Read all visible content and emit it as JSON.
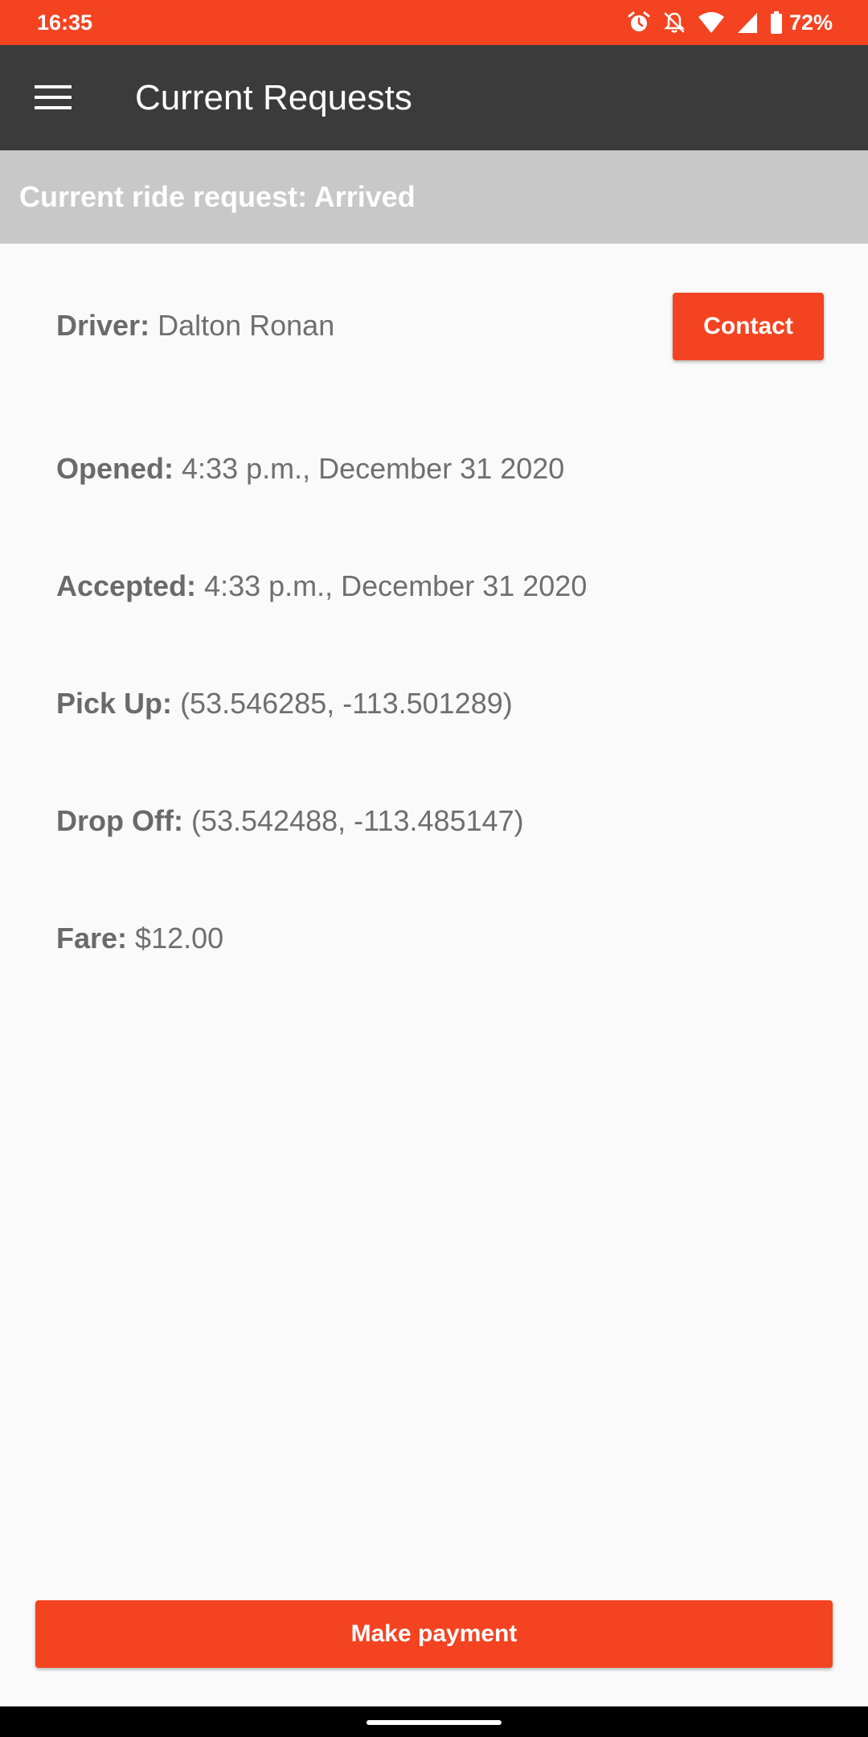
{
  "status_bar": {
    "time": "16:35",
    "battery": "72%",
    "icons": [
      "alarm-icon",
      "notifications-off-icon",
      "wifi-icon",
      "cell-signal-icon",
      "battery-icon"
    ]
  },
  "app_bar": {
    "title": "Current Requests",
    "menu_icon": "menu-icon"
  },
  "banner": {
    "text": "Current ride request: Arrived"
  },
  "details": {
    "driver_label": "Driver:",
    "driver_value": "Dalton Ronan",
    "opened_label": "Opened:",
    "opened_value": "4:33 p.m., December 31 2020",
    "accepted_label": "Accepted:",
    "accepted_value": "4:33 p.m., December 31 2020",
    "pickup_label": "Pick Up:",
    "pickup_value": "(53.546285, -113.501289)",
    "dropoff_label": "Drop Off:",
    "dropoff_value": "(53.542488, -113.485147)",
    "fare_label": "Fare:",
    "fare_value": "$12.00"
  },
  "buttons": {
    "contact_label": "Contact",
    "pay_label": "Make payment"
  },
  "colors": {
    "accent": "#f44321",
    "app_bar": "#3b3b3b",
    "banner": "#c8c8c8",
    "background": "#fafafa",
    "text": "#6a6a6a"
  }
}
